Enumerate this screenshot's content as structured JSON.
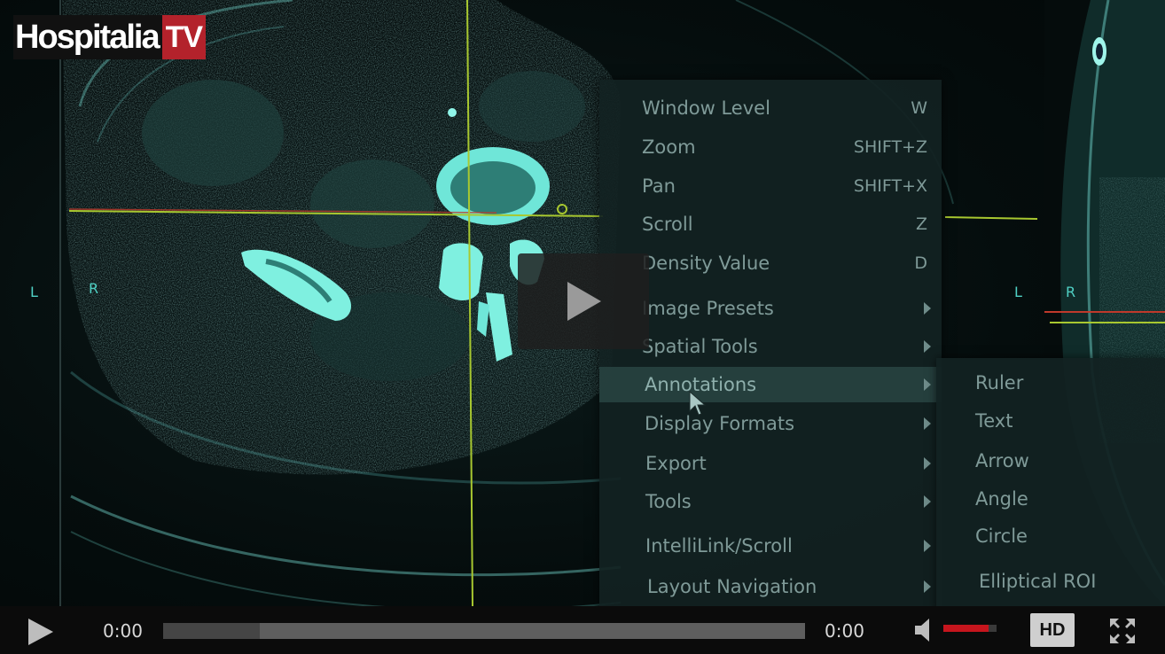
{
  "brand": {
    "name": "Hospitalia",
    "suffix": "TV",
    "accent": "#b3222b"
  },
  "orientation": {
    "left_view": [
      "L",
      "R"
    ],
    "right_view": [
      "L",
      "R"
    ]
  },
  "context_menu": {
    "items": [
      {
        "label": "Window Level",
        "shortcut": "W"
      },
      {
        "label": "Zoom",
        "shortcut": "SHIFT+Z"
      },
      {
        "label": "Pan",
        "shortcut": "SHIFT+X"
      },
      {
        "label": "Scroll",
        "shortcut": "Z"
      },
      {
        "label": "Density Value",
        "shortcut": "D"
      },
      {
        "label": "Image Presets",
        "submenu": true
      },
      {
        "label": "Spatial Tools",
        "submenu": true
      },
      {
        "label": "Annotations",
        "submenu": true,
        "highlighted": true
      },
      {
        "label": "Display Formats",
        "submenu": true
      },
      {
        "label": "Export",
        "submenu": true
      },
      {
        "label": "Tools",
        "submenu": true
      },
      {
        "label": "IntelliLink/Scroll",
        "submenu": true
      },
      {
        "label": "Layout Navigation",
        "submenu": true
      }
    ]
  },
  "annotations_submenu": {
    "items": [
      "Ruler",
      "Text",
      "Arrow",
      "Angle",
      "Circle",
      "Elliptical ROI"
    ]
  },
  "player": {
    "current_time": "0:00",
    "duration": "0:00",
    "buffered_fraction": 0.15,
    "volume_fraction": 0.85,
    "hd_label": "HD",
    "accent": "#c6151d"
  }
}
